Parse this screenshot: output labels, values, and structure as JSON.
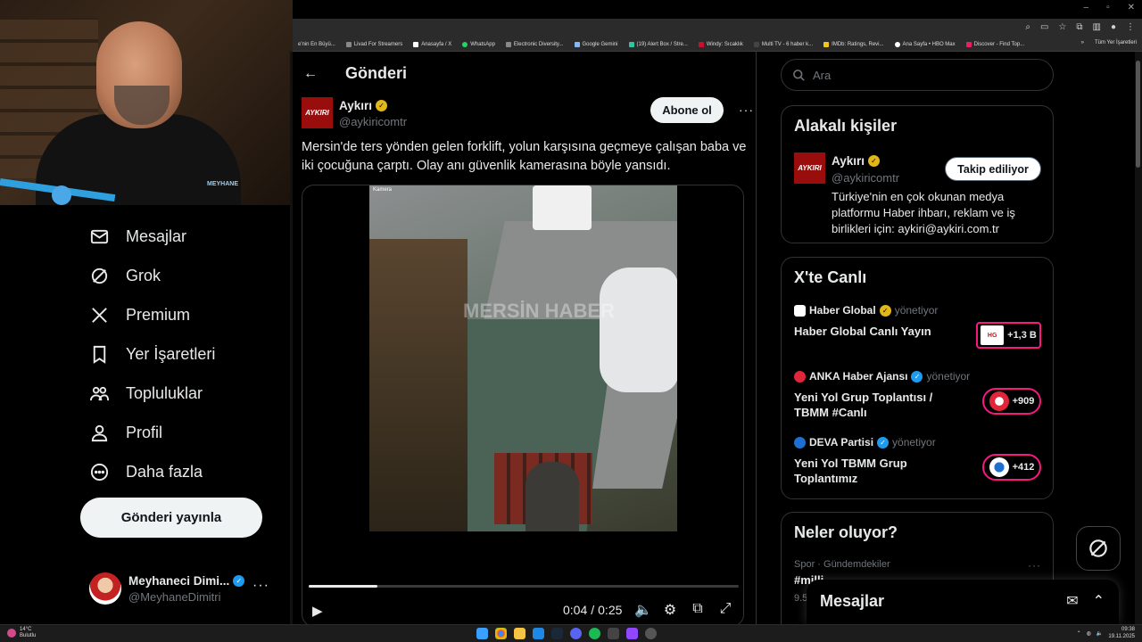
{
  "browser": {
    "window_controls": [
      "–",
      "▫",
      "✕"
    ],
    "bookmarks": [
      "e'nin En Büyü...",
      "Livad For Streamers",
      "Anasayfa / X",
      "WhatsApp",
      "Electronic Diversity...",
      "Google Gemini",
      "(19) Alert Box / Stre...",
      "Windy: Sıcaklık",
      "Multi TV - 6 haber k...",
      "IMDb: Ratings, Revi...",
      "Ana Sayfa • HBO Max",
      "Discover - Find Top..."
    ],
    "bookmarks_more": "»",
    "bookmarks_all": "Tüm Yer İşaretleri"
  },
  "webcam": {
    "logo_text": "MEYHANE"
  },
  "nav": {
    "items": [
      {
        "label": "Mesajlar",
        "icon": "mail-icon"
      },
      {
        "label": "Grok",
        "icon": "grok-icon"
      },
      {
        "label": "Premium",
        "icon": "x-logo-icon"
      },
      {
        "label": "Yer İşaretleri",
        "icon": "bookmark-icon"
      },
      {
        "label": "Topluluklar",
        "icon": "communities-icon"
      },
      {
        "label": "Profil",
        "icon": "person-icon"
      },
      {
        "label": "Daha fazla",
        "icon": "more-circle-icon"
      }
    ],
    "post_button": "Gönderi yayınla",
    "profile": {
      "name": "Meyhaneci Dimi...",
      "handle": "@MeyhaneDimitri",
      "more": "···"
    }
  },
  "main": {
    "header_title": "Gönderi",
    "tweet": {
      "avatar_text": "AYKIRI",
      "name": "Aykırı",
      "handle": "@aykiricomtr",
      "follow_label": "Abone ol",
      "more": "···",
      "text": "Mersin'de ters yönden gelen forklift, yolun karşısına geçmeye çalışan baba ve iki çocuğuna çarptı.  Olay anı güvenlik kamerasına böyle yansıdı."
    },
    "video": {
      "watermark": "MERSİN HABER",
      "cam_label": "Kamera",
      "current_time": "0:04",
      "separator": "/",
      "duration": "0:25",
      "progress": 0.16
    }
  },
  "right": {
    "search_placeholder": "Ara",
    "related": {
      "title": "Alakalı kişiler",
      "avatar_text": "AYKIRI",
      "name": "Aykırı",
      "handle": "@aykiricomtr",
      "button": "Takip ediliyor",
      "bio": "Türkiye'nin en çok okunan medya platformu Haber ihbarı, reklam ve iş birlikleri için: aykiri@aykiri.com.tr"
    },
    "live": {
      "title": "X'te Canlı",
      "items": [
        {
          "host": "Haber Global",
          "status": "yönetiyor",
          "title": "Haber Global Canlı Yayın",
          "count": "+1,3 B",
          "logo": "HG"
        },
        {
          "host": "ANKA Haber Ajansı",
          "status": "yönetiyor",
          "title": "Yeni Yol Grup Toplantısı / TBMM #Canlı",
          "count": "+909",
          "logo": ""
        },
        {
          "host": "DEVA Partisi",
          "status": "yönetiyor",
          "title": "Yeni Yol TBMM Grup Toplantımız",
          "count": "+412",
          "logo": ""
        }
      ]
    },
    "trends": {
      "title": "Neler oluyor?",
      "meta": "Spor · Gündemdekiler",
      "tag": "#milli...",
      "count": "9.5...",
      "more": "···"
    }
  },
  "messages_drawer": {
    "title": "Mesajlar"
  },
  "taskbar": {
    "weather_temp": "14°C",
    "weather_desc": "Bulutlu",
    "time": "09:38",
    "date": "19.11.2025"
  },
  "colors": {
    "background": "#000000",
    "accent_pink": "#f91880",
    "verified_gold": "#e2b719",
    "verified_blue": "#1d9bf0",
    "aykiri_red": "#9a0d0d"
  }
}
